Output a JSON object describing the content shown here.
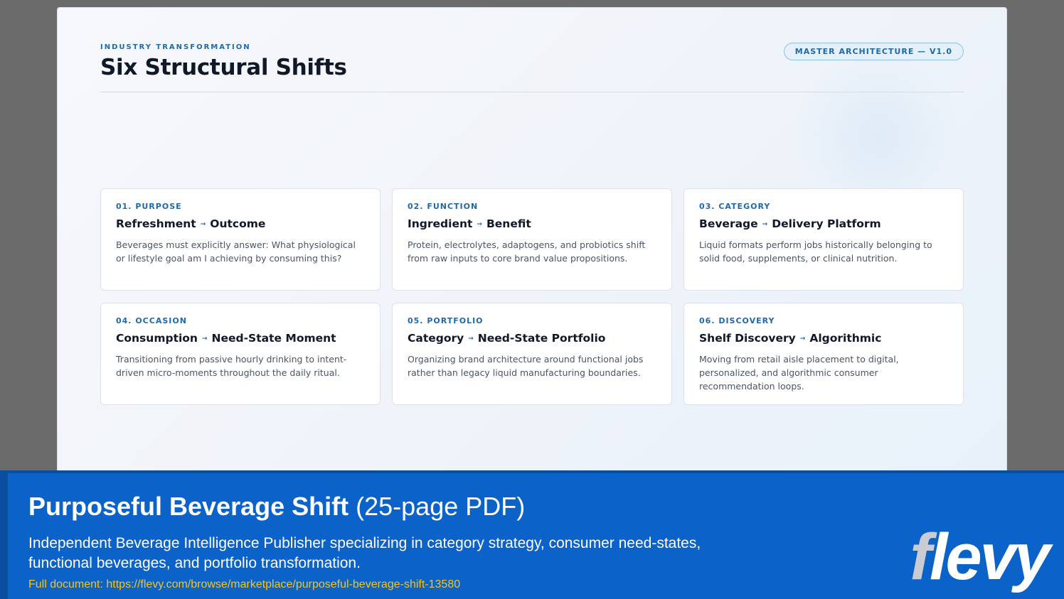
{
  "slide": {
    "eyebrow": "INDUSTRY TRANSFORMATION",
    "title": "Six Structural Shifts",
    "badge": "MASTER ARCHITECTURE — V1.0"
  },
  "cards": [
    {
      "num": "01. PURPOSE",
      "from": "Refreshment",
      "to": "Outcome",
      "desc": "Beverages must explicitly answer: What physiological or lifestyle goal am I achieving by consuming this?"
    },
    {
      "num": "02. FUNCTION",
      "from": "Ingredient",
      "to": "Benefit",
      "desc": "Protein, electrolytes, adaptogens, and probiotics shift from raw inputs to core brand value propositions."
    },
    {
      "num": "03. CATEGORY",
      "from": "Beverage",
      "to": "Delivery Platform",
      "desc": "Liquid formats perform jobs historically belonging to solid food, supplements, or clinical nutrition."
    },
    {
      "num": "04. OCCASION",
      "from": "Consumption",
      "to": "Need-State Moment",
      "desc": "Transitioning from passive hourly drinking to intent-driven micro-moments throughout the daily ritual."
    },
    {
      "num": "05. PORTFOLIO",
      "from": "Category",
      "to": "Need-State Portfolio",
      "desc": "Organizing brand architecture around functional jobs rather than legacy liquid manufacturing boundaries."
    },
    {
      "num": "06. DISCOVERY",
      "from": "Shelf Discovery",
      "to": "Algorithmic",
      "desc": "Moving from retail aisle placement to digital, personalized, and algorithmic consumer recommendation loops."
    }
  ],
  "arrow_glyph": "→",
  "banner": {
    "title_bold": "Purposeful Beverage Shift",
    "title_light": "(25-page PDF)",
    "description": "Independent Beverage Intelligence Publisher specializing in category strategy, consumer need-states, functional beverages, and portfolio transformation.",
    "link": "Full document: https://flevy.com/browse/marketplace/purposeful-beverage-shift-13580",
    "logo_first": "f",
    "logo_rest": "levy"
  },
  "colors": {
    "accent": "#1e6aa8",
    "banner": "#0b63c9",
    "link": "#f5c518"
  }
}
